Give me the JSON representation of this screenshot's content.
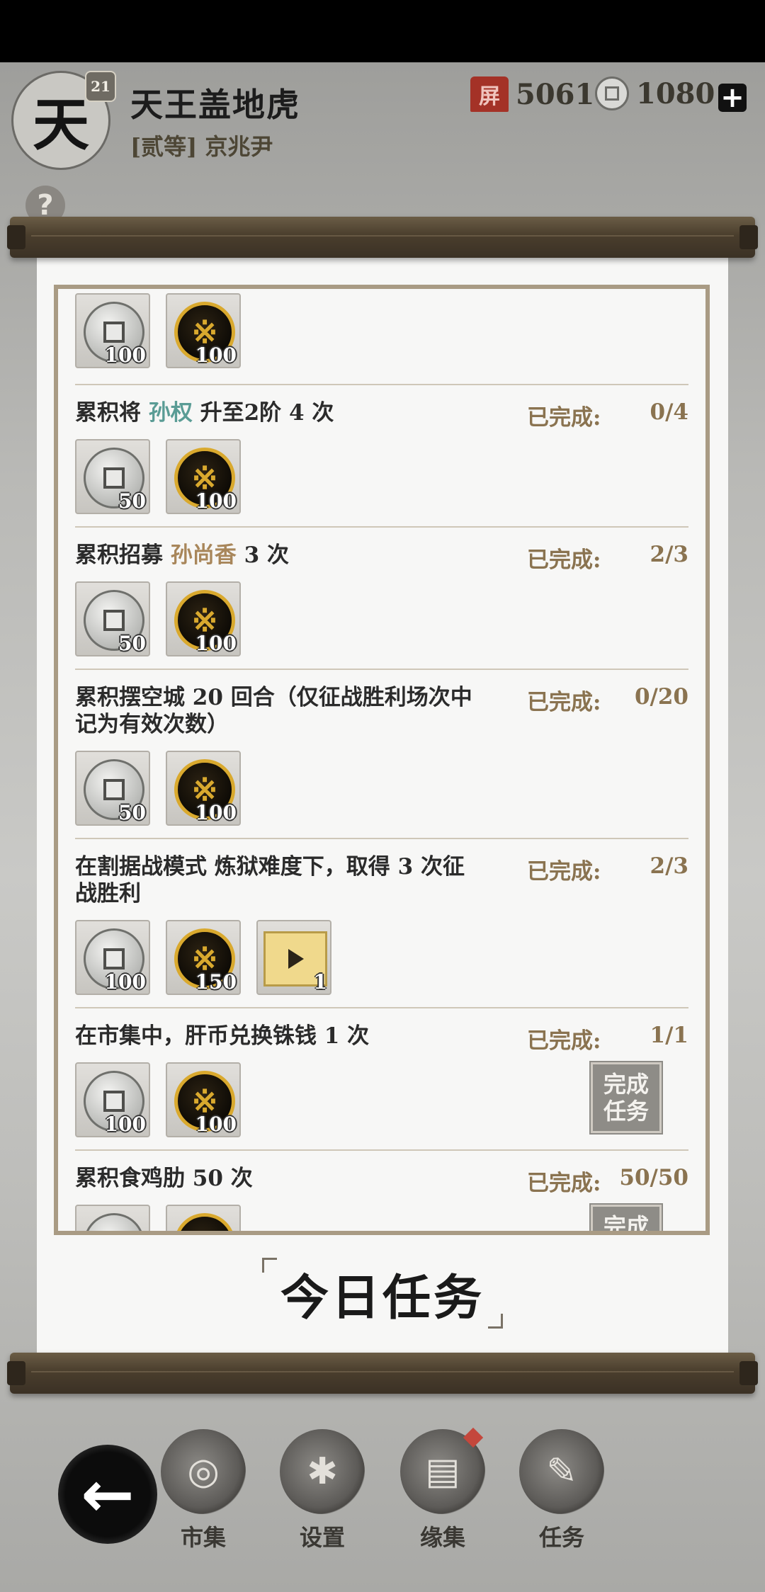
{
  "header": {
    "avatar_glyph": "天",
    "level": "21",
    "player_name": "天王盖地虎",
    "rank": "[贰等] 京兆尹",
    "currency_red_icon": "屏",
    "currency_red_value": "5061",
    "currency_coin_value": "1080",
    "plus_label": "+",
    "help_label": "?"
  },
  "tasks": {
    "top_rewards": [
      "100",
      "100"
    ],
    "done_label": "已完成:",
    "complete_label_1": "完成",
    "complete_label_2": "任务",
    "items": [
      {
        "pre": "累积将 ",
        "hl": "孙权",
        "post": " 升至2阶 4 次",
        "progress": "0/4",
        "rewards": [
          "50",
          "100"
        ]
      },
      {
        "pre": "累积招募 ",
        "hl": "孙尚香",
        "post": " 3 次",
        "progress": "2/3",
        "rewards": [
          "50",
          "100"
        ]
      },
      {
        "text": "累积摆空城 20 回合（仅征战胜利场次中记为有效次数）",
        "progress": "0/20",
        "rewards": [
          "50",
          "100"
        ]
      },
      {
        "text": "在割据战模式 炼狱难度下，取得 3 次征战胜利",
        "progress": "2/3",
        "rewards": [
          "100",
          "150",
          "1"
        ]
      },
      {
        "text": "在市集中，肝币兑换铢钱 1 次",
        "progress": "1/1",
        "rewards": [
          "100",
          "100"
        ]
      },
      {
        "text": "累积食鸡肋 50 次",
        "progress": "50/50"
      }
    ]
  },
  "banner_title": "今日任务",
  "nav": {
    "back_glyph": "←",
    "items": [
      {
        "label": "市集",
        "icon": "market-icon"
      },
      {
        "label": "设置",
        "icon": "settings-icon"
      },
      {
        "label": "缘集",
        "icon": "collection-icon"
      },
      {
        "label": "任务",
        "icon": "task-scroll-icon"
      }
    ]
  },
  "colors": {
    "accent_teal": "#5a9c95",
    "accent_gold": "#a8865a",
    "done_brown": "#8a7350"
  }
}
